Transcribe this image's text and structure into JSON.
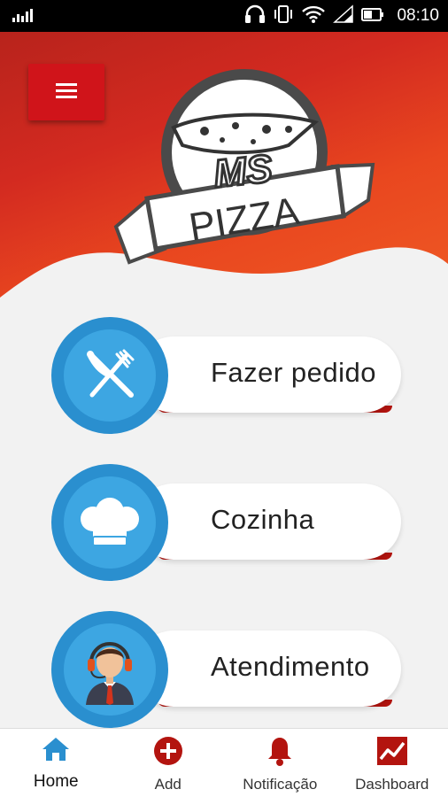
{
  "status_bar": {
    "time": "08:10",
    "icons": [
      "signal-activity-icon",
      "headphones-icon",
      "vibrate-icon",
      "wifi-icon",
      "cell-signal-icon",
      "battery-icon"
    ]
  },
  "header": {
    "menu_icon": "hamburger-menu-icon",
    "logo": {
      "line1": "MS",
      "line2": "PIZZA"
    },
    "colors": {
      "gradient_dark": "#b8231c",
      "gradient_light": "#ef5a24",
      "menu_button": "#d0141a"
    }
  },
  "actions": [
    {
      "label": "Fazer pedido",
      "icon": "fork-knife-icon"
    },
    {
      "label": "Cozinha",
      "icon": "chef-hat-icon"
    },
    {
      "label": "Atendimento",
      "icon": "support-agent-icon"
    }
  ],
  "bottom_nav": {
    "items": [
      {
        "label": "Home",
        "icon": "home-icon",
        "active": true
      },
      {
        "label": "Add",
        "icon": "add-circle-icon",
        "active": false
      },
      {
        "label": "Notificação",
        "icon": "bell-icon",
        "active": false
      },
      {
        "label": "Dashboard",
        "icon": "dashboard-chart-icon",
        "active": false
      }
    ],
    "colors": {
      "active": "#2a8fcf",
      "inactive": "#b3140f"
    }
  }
}
